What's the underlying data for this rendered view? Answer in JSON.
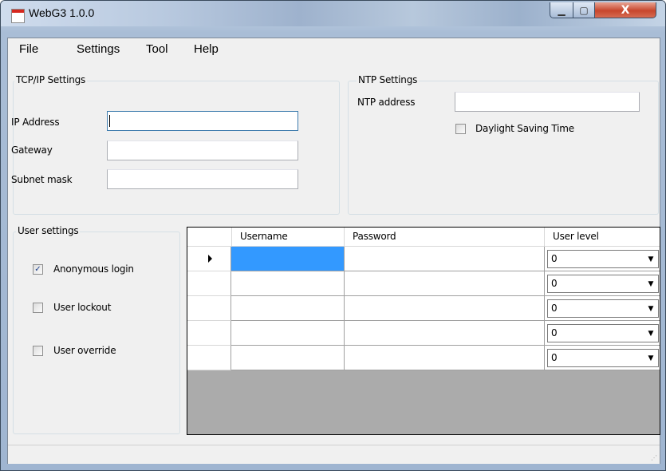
{
  "window": {
    "title": "WebG3 1.0.0"
  },
  "titlebar": {
    "min_glyph": "▁",
    "max_glyph": "▢",
    "close_glyph": "X"
  },
  "menu": [
    "File",
    "Settings",
    "Tool",
    "Help"
  ],
  "tcpip": {
    "title": "TCP/IP Settings",
    "ip_label": "IP Address",
    "ip_value": "",
    "gateway_label": "Gateway",
    "gateway_value": "",
    "subnet_label": "Subnet mask",
    "subnet_value": ""
  },
  "ntp": {
    "title": "NTP Settings",
    "address_label": "NTP address",
    "address_value": "",
    "dst_label": "Daylight Saving Time",
    "dst_checked": false
  },
  "user_settings": {
    "title": "User settings",
    "options": [
      {
        "label": "Anonymous login",
        "checked": true
      },
      {
        "label": "User lockout",
        "checked": false
      },
      {
        "label": "User override",
        "checked": false
      }
    ]
  },
  "grid": {
    "columns": [
      "Username",
      "Password",
      "User level"
    ],
    "rows": [
      {
        "username": "",
        "password": "",
        "level": "0"
      },
      {
        "username": "",
        "password": "",
        "level": "0"
      },
      {
        "username": "",
        "password": "",
        "level": "0"
      },
      {
        "username": "",
        "password": "",
        "level": "0"
      },
      {
        "username": "",
        "password": "",
        "level": "0"
      }
    ],
    "combo_arrow": "▼"
  },
  "status": {
    "grip": "⋰"
  }
}
